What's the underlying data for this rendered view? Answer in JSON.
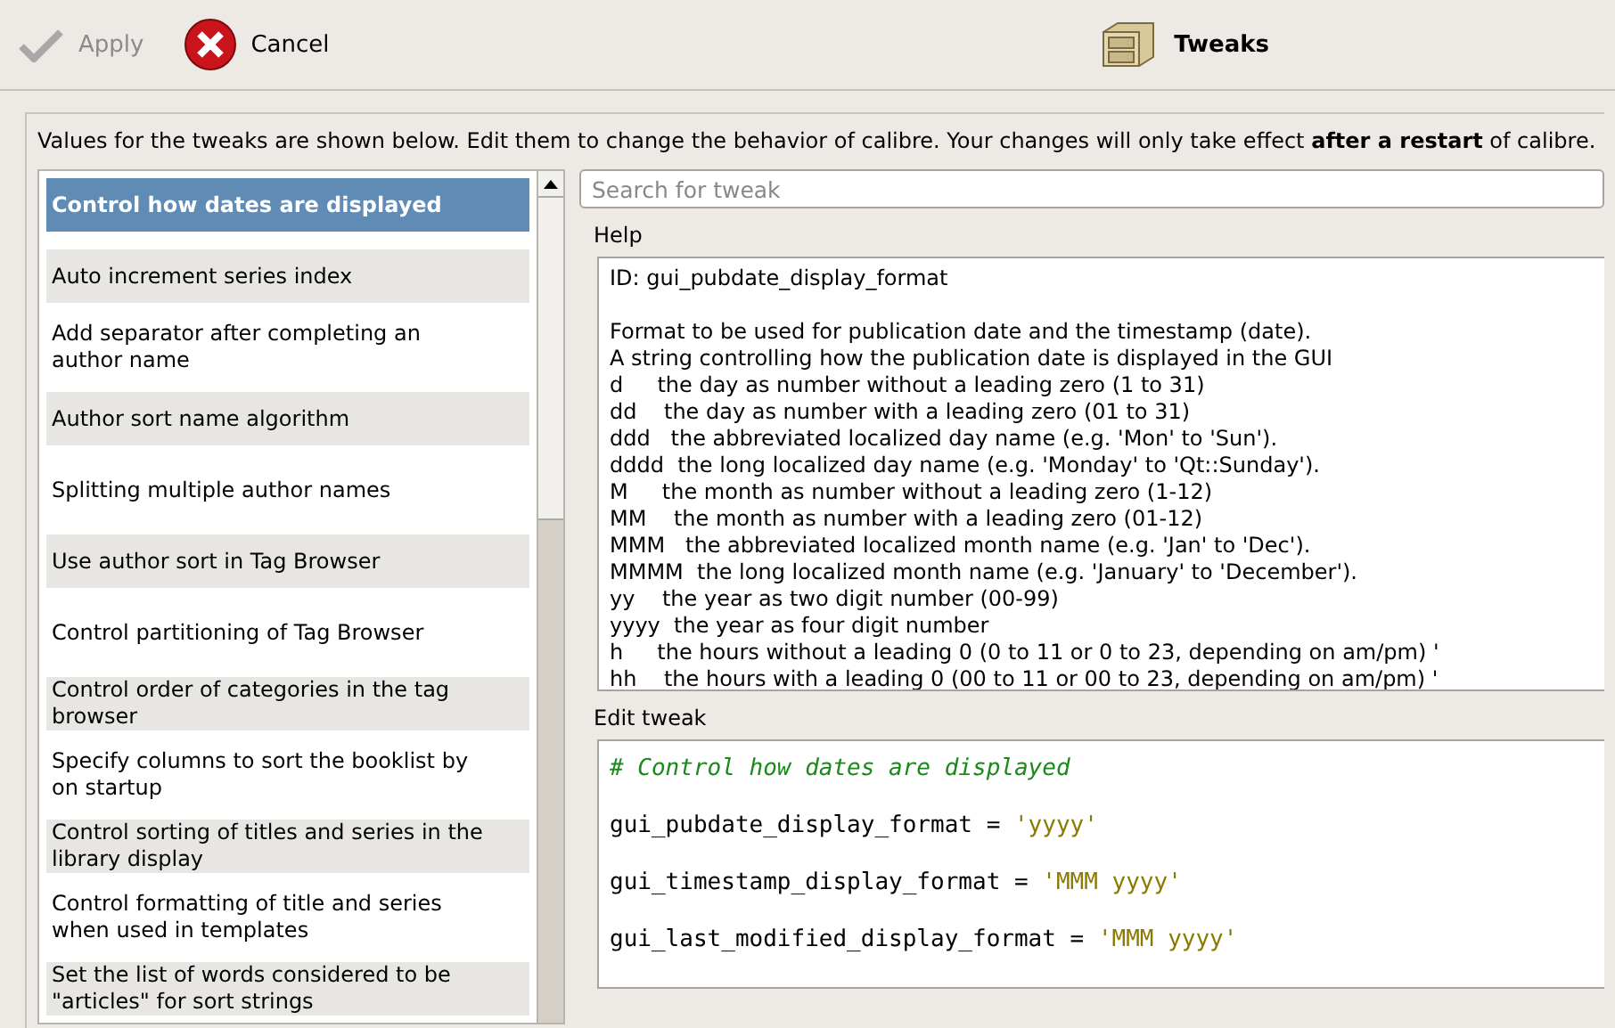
{
  "toolbar": {
    "apply": {
      "label": "Apply",
      "disabled": true
    },
    "cancel": {
      "label": "Cancel"
    },
    "title": "Tweaks"
  },
  "intro": "Values for the tweaks are shown below. Edit them to change the behavior of calibre. Your changes will only take effect **after a restart** of calibre.",
  "tweaks": [
    {
      "label": "Control how dates are displayed",
      "selected": true
    },
    {
      "label": "Auto increment series index",
      "selected": false
    },
    {
      "label": "Add separator after completing an author name",
      "selected": false
    },
    {
      "label": "Author sort name algorithm",
      "selected": false
    },
    {
      "label": "Splitting multiple author names",
      "selected": false
    },
    {
      "label": "Use author sort in Tag Browser",
      "selected": false
    },
    {
      "label": "Control partitioning of Tag Browser",
      "selected": false
    },
    {
      "label": "Control order of categories in the tag browser",
      "selected": false
    },
    {
      "label": "Specify columns to sort the booklist by on startup",
      "selected": false
    },
    {
      "label": "Control sorting of titles and series in the library display",
      "selected": false
    },
    {
      "label": "Control formatting of title and series when used in templates",
      "selected": false
    },
    {
      "label": "Set the list of words considered to be \"articles\" for sort strings",
      "selected": false
    }
  ],
  "search": {
    "placeholder": "Search for tweak"
  },
  "help": {
    "title": "Help",
    "id": "ID: gui_pubdate_display_format",
    "lines": [
      "Format to be used for publication date and the timestamp (date).",
      "A string controlling how the publication date is displayed in the GUI",
      "d     the day as number without a leading zero (1 to 31)",
      "dd    the day as number with a leading zero (01 to 31)",
      "ddd   the abbreviated localized day name (e.g. 'Mon' to 'Sun').",
      "dddd  the long localized day name (e.g. 'Monday' to 'Qt::Sunday').",
      "M     the month as number without a leading zero (1-12)",
      "MM    the month as number with a leading zero (01-12)",
      "MMM   the abbreviated localized month name (e.g. 'Jan' to 'Dec').",
      "MMMM  the long localized month name (e.g. 'January' to 'December').",
      "yy    the year as two digit number (00-99)",
      "yyyy  the year as four digit number",
      "h     the hours without a leading 0 (0 to 11 or 0 to 23, depending on am/pm) '",
      "hh    the hours with a leading 0 (00 to 11 or 00 to 23, depending on am/pm) '"
    ]
  },
  "edit": {
    "title": "Edit tweak",
    "lines": [
      {
        "kind": "comment",
        "text": "# Control how dates are displayed"
      },
      {
        "kind": "assignment",
        "text": "gui_pubdate_display_format =",
        "value": "'yyyy'"
      },
      {
        "kind": "assignment",
        "text": "gui_timestamp_display_format =",
        "value": "'MMM yyyy'"
      },
      {
        "kind": "assignment",
        "text": "gui_last_modified_display_format =",
        "value": "'MMM yyyy'"
      }
    ]
  }
}
